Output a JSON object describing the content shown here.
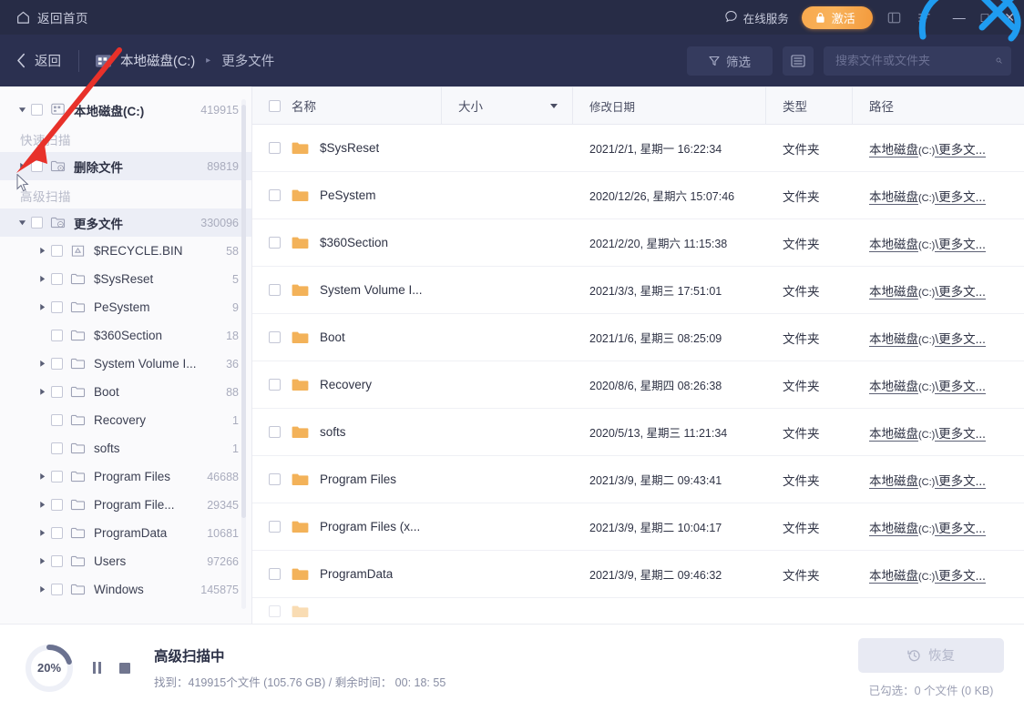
{
  "titlebar": {
    "home_label": "返回首页",
    "service_label": "在线服务",
    "activate_label": "激活",
    "minimize": "—",
    "maximize": "□",
    "close": "✕"
  },
  "navbar": {
    "back_label": "返回",
    "breadcrumb": [
      "本地磁盘(C:)",
      "更多文件"
    ],
    "separator": "▸",
    "filter_label": "筛选",
    "search_placeholder": "搜索文件或文件夹",
    "search_value": ""
  },
  "sidebar": {
    "root": {
      "label": "本地磁盘(C:)",
      "count": "419915",
      "expanded": true
    },
    "sections": [
      {
        "title": "快速扫描",
        "items": [
          {
            "label": "删除文件",
            "count": "89819",
            "expanded": false,
            "selected": true,
            "icon": "folder-clock-icon",
            "indent": 0,
            "bold": true
          }
        ]
      },
      {
        "title": "高级扫描",
        "items": [
          {
            "label": "更多文件",
            "count": "330096",
            "expanded": true,
            "selected": true,
            "icon": "folder-search-icon",
            "indent": 0,
            "bold": true
          },
          {
            "label": "$RECYCLE.BIN",
            "count": "58",
            "expanded": false,
            "selected": false,
            "icon": "recycle-icon",
            "indent": 1,
            "bold": false
          },
          {
            "label": "$SysReset",
            "count": "5",
            "expanded": false,
            "selected": false,
            "icon": "folder-icon",
            "indent": 1,
            "bold": false
          },
          {
            "label": "PeSystem",
            "count": "9",
            "expanded": false,
            "selected": false,
            "icon": "folder-icon",
            "indent": 1,
            "bold": false
          },
          {
            "label": "$360Section",
            "count": "18",
            "expanded": null,
            "selected": false,
            "icon": "folder-icon",
            "indent": 1,
            "bold": false
          },
          {
            "label": "System Volume I...",
            "count": "36",
            "expanded": false,
            "selected": false,
            "icon": "folder-icon",
            "indent": 1,
            "bold": false
          },
          {
            "label": "Boot",
            "count": "88",
            "expanded": false,
            "selected": false,
            "icon": "folder-icon",
            "indent": 1,
            "bold": false
          },
          {
            "label": "Recovery",
            "count": "1",
            "expanded": null,
            "selected": false,
            "icon": "folder-icon",
            "indent": 1,
            "bold": false
          },
          {
            "label": "softs",
            "count": "1",
            "expanded": null,
            "selected": false,
            "icon": "folder-icon",
            "indent": 1,
            "bold": false
          },
          {
            "label": "Program Files",
            "count": "46688",
            "expanded": false,
            "selected": false,
            "icon": "folder-icon",
            "indent": 1,
            "bold": false
          },
          {
            "label": "Program File...",
            "count": "29345",
            "expanded": false,
            "selected": false,
            "icon": "folder-icon",
            "indent": 1,
            "bold": false
          },
          {
            "label": "ProgramData",
            "count": "10681",
            "expanded": false,
            "selected": false,
            "icon": "folder-icon",
            "indent": 1,
            "bold": false
          },
          {
            "label": "Users",
            "count": "97266",
            "expanded": false,
            "selected": false,
            "icon": "folder-icon",
            "indent": 1,
            "bold": false
          },
          {
            "label": "Windows",
            "count": "145875",
            "expanded": false,
            "selected": false,
            "icon": "folder-icon",
            "indent": 1,
            "bold": false
          }
        ]
      }
    ]
  },
  "table": {
    "columns": [
      "名称",
      "大小",
      "修改日期",
      "类型",
      "路径"
    ],
    "sort_column": "大小",
    "rows": [
      {
        "name": "$SysReset",
        "size": "",
        "date": "2021/2/1, 星期一 16:22:34",
        "type": "文件夹",
        "path_head": "本地磁盘",
        "path_drive": "(C:)",
        "path_tail": "\\更多文..."
      },
      {
        "name": "PeSystem",
        "size": "",
        "date": "2020/12/26, 星期六 15:07:46",
        "type": "文件夹",
        "path_head": "本地磁盘",
        "path_drive": "(C:)",
        "path_tail": "\\更多文..."
      },
      {
        "name": "$360Section",
        "size": "",
        "date": "2021/2/20, 星期六 11:15:38",
        "type": "文件夹",
        "path_head": "本地磁盘",
        "path_drive": "(C:)",
        "path_tail": "\\更多文..."
      },
      {
        "name": "System Volume I...",
        "size": "",
        "date": "2021/3/3, 星期三 17:51:01",
        "type": "文件夹",
        "path_head": "本地磁盘",
        "path_drive": "(C:)",
        "path_tail": "\\更多文..."
      },
      {
        "name": "Boot",
        "size": "",
        "date": "2021/1/6, 星期三 08:25:09",
        "type": "文件夹",
        "path_head": "本地磁盘",
        "path_drive": "(C:)",
        "path_tail": "\\更多文..."
      },
      {
        "name": "Recovery",
        "size": "",
        "date": "2020/8/6, 星期四 08:26:38",
        "type": "文件夹",
        "path_head": "本地磁盘",
        "path_drive": "(C:)",
        "path_tail": "\\更多文..."
      },
      {
        "name": "softs",
        "size": "",
        "date": "2020/5/13, 星期三 11:21:34",
        "type": "文件夹",
        "path_head": "本地磁盘",
        "path_drive": "(C:)",
        "path_tail": "\\更多文..."
      },
      {
        "name": "Program Files",
        "size": "",
        "date": "2021/3/9, 星期二 09:43:41",
        "type": "文件夹",
        "path_head": "本地磁盘",
        "path_drive": "(C:)",
        "path_tail": "\\更多文..."
      },
      {
        "name": "Program Files (x...",
        "size": "",
        "date": "2021/3/9, 星期二 10:04:17",
        "type": "文件夹",
        "path_head": "本地磁盘",
        "path_drive": "(C:)",
        "path_tail": "\\更多文..."
      },
      {
        "name": "ProgramData",
        "size": "",
        "date": "2021/3/9, 星期二 09:46:32",
        "type": "文件夹",
        "path_head": "本地磁盘",
        "path_drive": "(C:)",
        "path_tail": "\\更多文..."
      }
    ]
  },
  "footer": {
    "progress_pct": "20%",
    "progress_value": 20,
    "scan_title": "高级扫描中",
    "scan_detail": "找到：419915个文件 (105.76 GB) / 剩余时间： 00: 18: 55",
    "restore_label": "恢复",
    "selected_info": "已勾选：0 个文件 (0 KB)"
  },
  "colors": {
    "titlebar_bg": "#272c46",
    "navbar_bg": "#2b3050",
    "accent_orange": "#f5a44a",
    "folder_orange": "#f3b259",
    "annotation_red": "#e8312a",
    "annotation_blue": "#1f9cf0"
  }
}
